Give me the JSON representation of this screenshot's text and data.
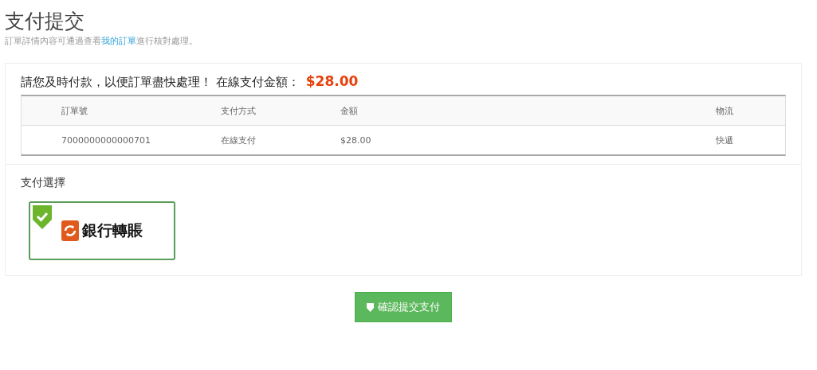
{
  "page": {
    "title": "支付提交",
    "subtitle_before": "訂單詳情內容可通過查看",
    "subtitle_link": "我的訂單",
    "subtitle_after": "進行核對處理。"
  },
  "notice": {
    "text": "請您及時付款，以便訂單盡快處理！ 在線支付金額：",
    "amount": "$28.00"
  },
  "table": {
    "columns": [
      "訂單號",
      "支付方式",
      "金額",
      "物流"
    ],
    "rows": [
      [
        "7000000000000701",
        "在線支付",
        "$28.00",
        "快遞"
      ]
    ]
  },
  "payment": {
    "title": "支付選擇",
    "options": [
      {
        "label": "銀行轉賬",
        "selected": true
      }
    ]
  },
  "submit_button": "確認提交支付"
}
